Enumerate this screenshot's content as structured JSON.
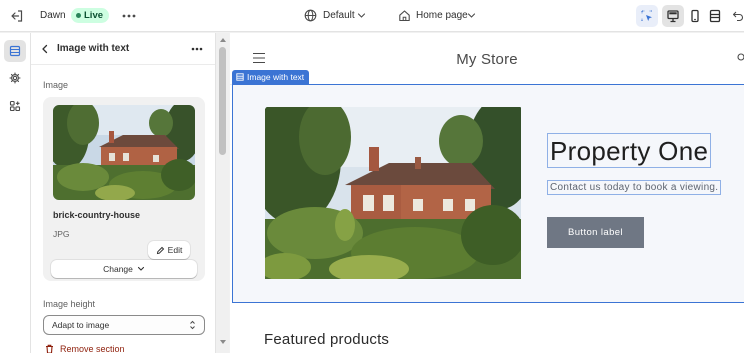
{
  "topbar": {
    "theme_name": "Dawn",
    "status_badge": "Live",
    "locale_selector": "Default",
    "page_selector": "Home page",
    "icons": {
      "exit": "exit-icon",
      "more": "more-horizontal-icon",
      "globe": "globe-icon",
      "home": "home-icon",
      "inspector": "inspector-cursor-icon",
      "desktop": "desktop-icon",
      "mobile": "mobile-icon",
      "fullwidth": "full-width-icon",
      "undo": "undo-icon"
    }
  },
  "rail": {
    "items": [
      {
        "name": "sections",
        "icon": "sections-icon",
        "active": true
      },
      {
        "name": "theme-settings",
        "icon": "gear-icon",
        "active": false
      },
      {
        "name": "apps",
        "icon": "apps-icon",
        "active": false
      }
    ]
  },
  "panel": {
    "title": "Image with text",
    "image_label": "Image",
    "edit_label": "Edit",
    "file_name": "brick-country-house",
    "file_type": "JPG",
    "change_label": "Change",
    "image_height_label": "Image height",
    "image_height_value": "Adapt to image",
    "remove_label": "Remove section"
  },
  "preview": {
    "store_name": "My Store",
    "section_tag": "Image with text",
    "heading": "Property One",
    "text": "Contact us today to book a viewing.",
    "button_label": "Button label",
    "next_section_title": "Featured products"
  },
  "colors": {
    "accent": "#3b74d4",
    "live_badge_bg": "#cdfee1",
    "live_badge_text": "#0c5132",
    "button_bg": "#6f7784",
    "remove_text": "#8e1f0b"
  }
}
